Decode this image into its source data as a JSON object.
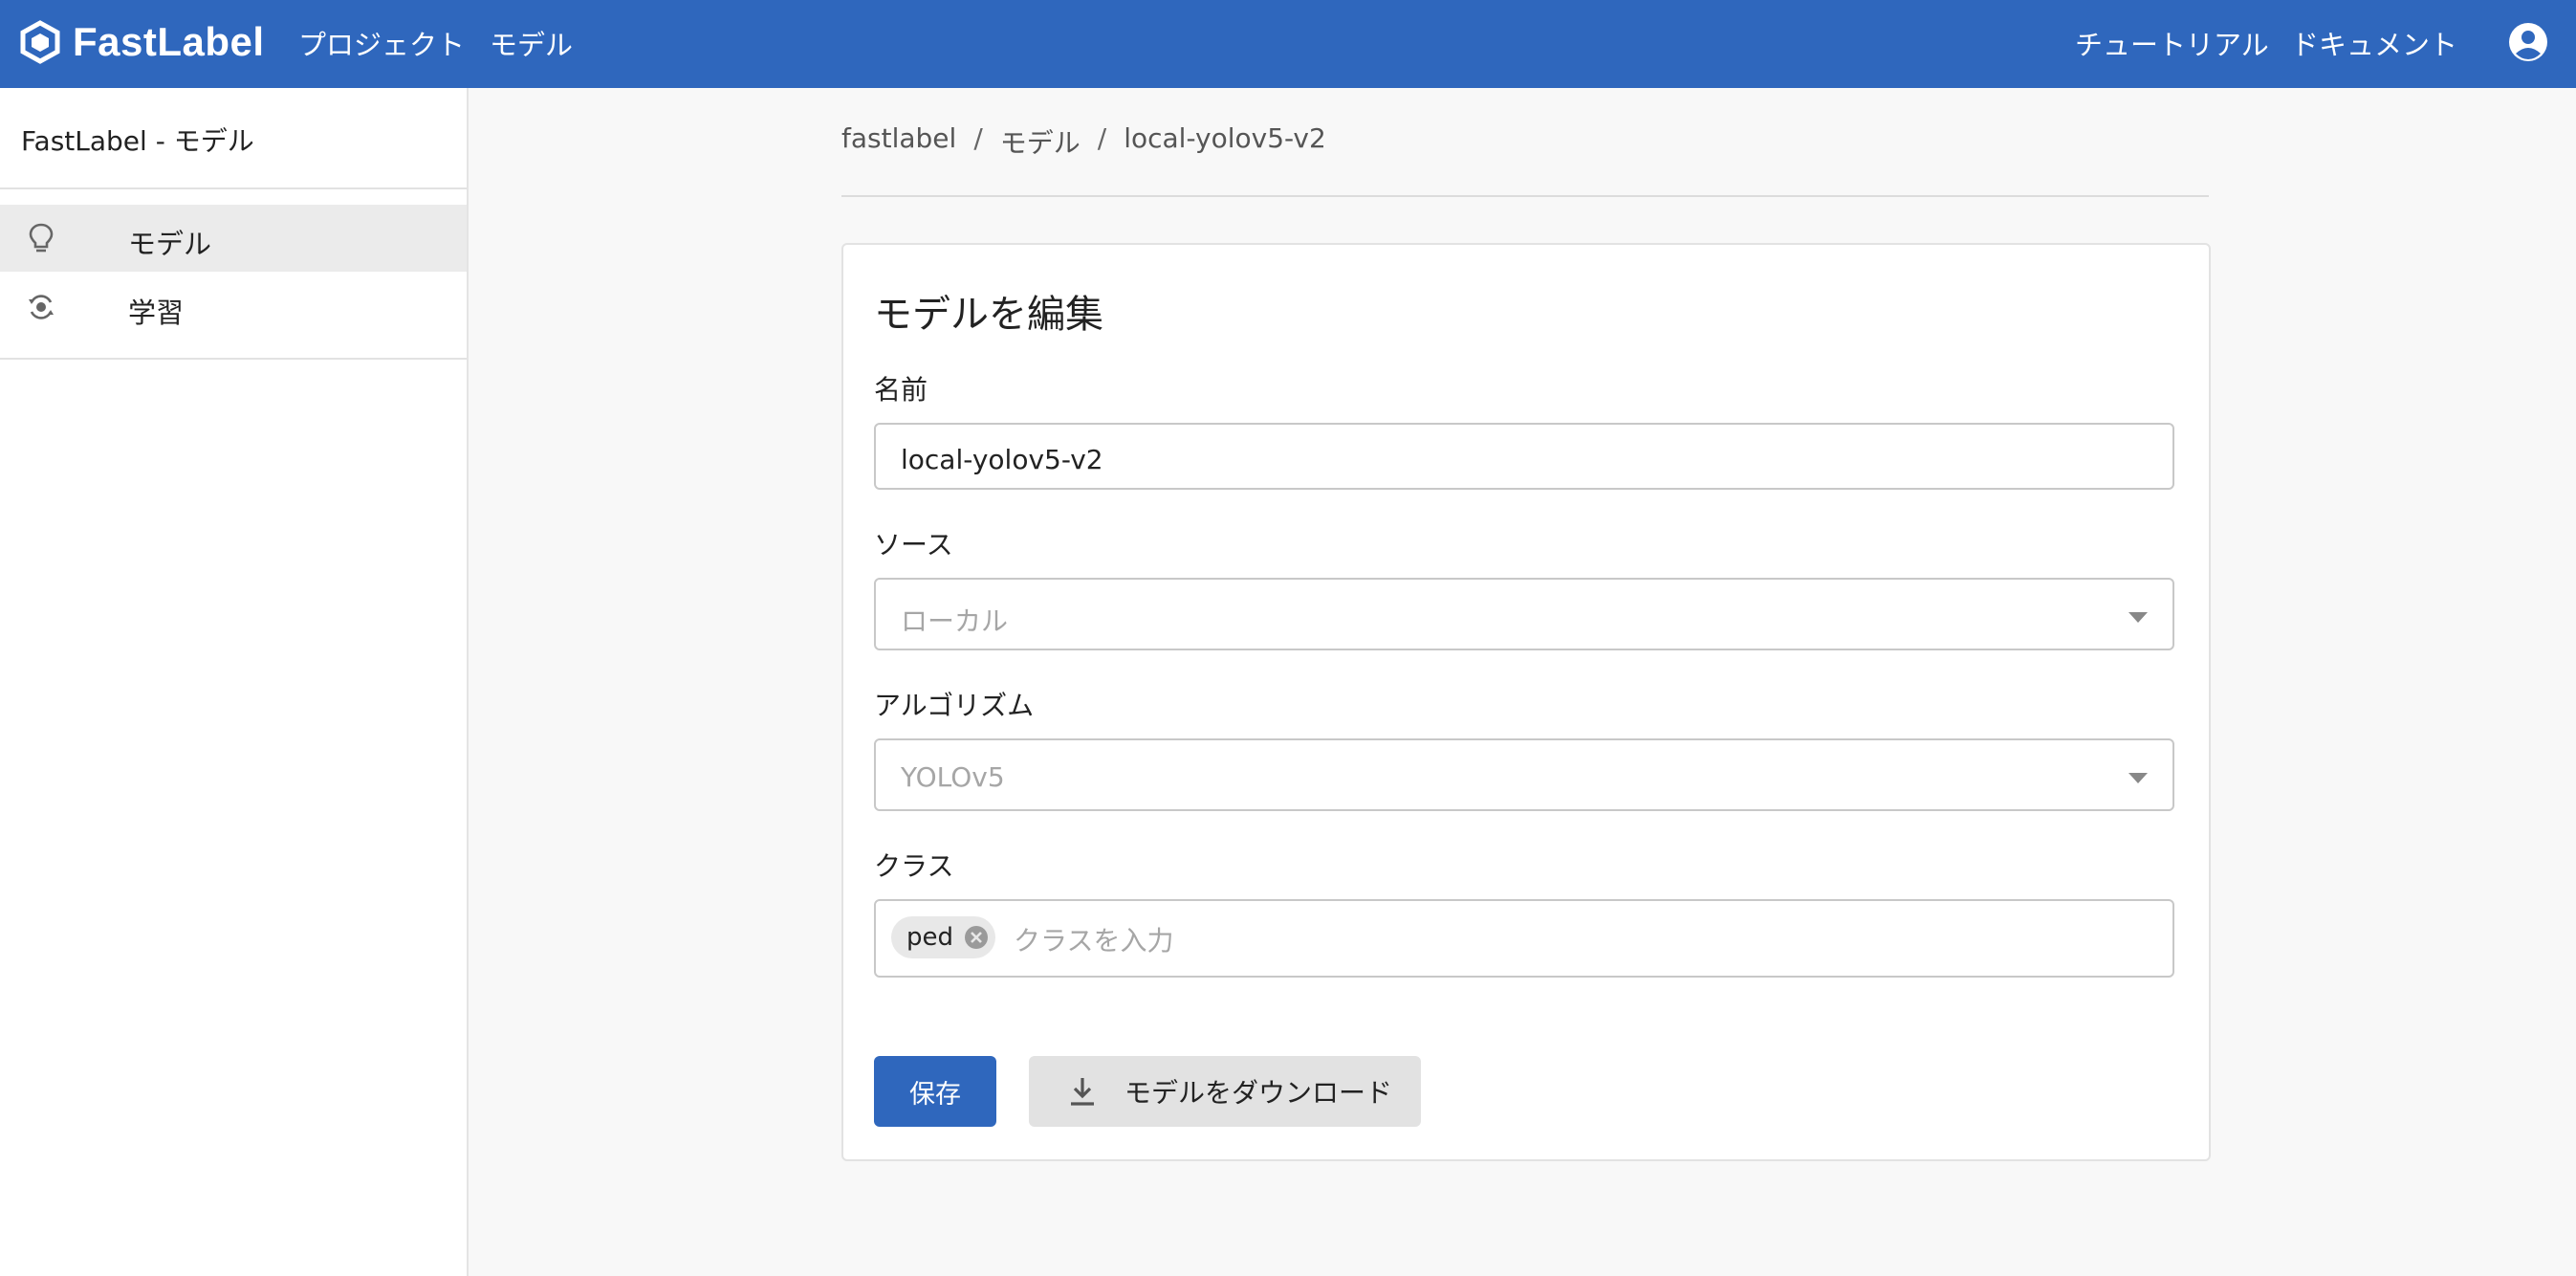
{
  "header": {
    "brand": "FastLabel",
    "nav": [
      "プロジェクト",
      "モデル"
    ],
    "right_links": [
      "チュートリアル",
      "ドキュメント"
    ],
    "account_icon": "account-circle-icon"
  },
  "sidebar": {
    "title": "FastLabel - モデル",
    "items": [
      {
        "label": "モデル",
        "icon": "lightbulb-icon",
        "active": true
      },
      {
        "label": "学習",
        "icon": "training-icon",
        "active": false
      }
    ]
  },
  "breadcrumb": [
    "fastlabel",
    "モデル",
    "local-yolov5-v2"
  ],
  "form": {
    "title": "モデルを編集",
    "name": {
      "label": "名前",
      "value": "local-yolov5-v2"
    },
    "source": {
      "label": "ソース",
      "value": "ローカル"
    },
    "algorithm": {
      "label": "アルゴリズム",
      "value": "YOLOv5"
    },
    "classes": {
      "label": "クラス",
      "chips": [
        "ped"
      ],
      "placeholder": "クラスを入力"
    },
    "save_label": "保存",
    "download_label": "モデルをダウンロード"
  },
  "colors": {
    "primary": "#2f67bd",
    "background": "#f8f8f8"
  }
}
